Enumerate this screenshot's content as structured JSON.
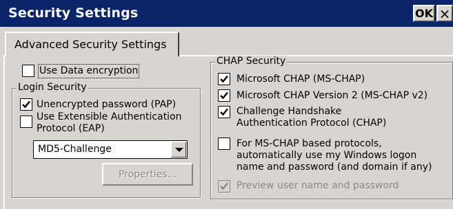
{
  "window": {
    "title": "Security Settings",
    "ok_label": "OK",
    "close_label": "×"
  },
  "tabs": [
    {
      "label": "Advanced Security Settings",
      "selected": true
    }
  ],
  "data_encryption": {
    "label": "Use Data encryption",
    "checked": false
  },
  "login_security": {
    "title": "Login Security",
    "pap": {
      "label": "Unencrypted password (PAP)",
      "checked": true
    },
    "eap": {
      "label_line1": "Use Extensible Authentication",
      "label_line2": "Protocol (EAP)",
      "checked": false
    },
    "eap_type": {
      "value": "MD5-Challenge"
    },
    "properties_label": "Properties..."
  },
  "chap_security": {
    "title": "CHAP Security",
    "ms_chap": {
      "label": "Microsoft CHAP (MS-CHAP)",
      "checked": true
    },
    "ms_chap_v2": {
      "label": "Microsoft CHAP Version 2 (MS-CHAP v2)",
      "checked": true
    },
    "chap": {
      "label_line1": "Challenge Handshake",
      "label_line2": "Authentication Protocol (CHAP)",
      "checked": true
    },
    "windows_logon": {
      "label_line1": "For MS-CHAP based protocols,",
      "label_line2": "automatically use my Windows logon",
      "label_line3": "name and password (and domain if any)",
      "checked": false
    },
    "preview": {
      "label": "Preview user name and password",
      "checked": true,
      "disabled": true
    }
  },
  "colors": {
    "titlebar": "#0a246a",
    "face": "#d8d4d0",
    "disabled_text": "#8a8a8a"
  }
}
